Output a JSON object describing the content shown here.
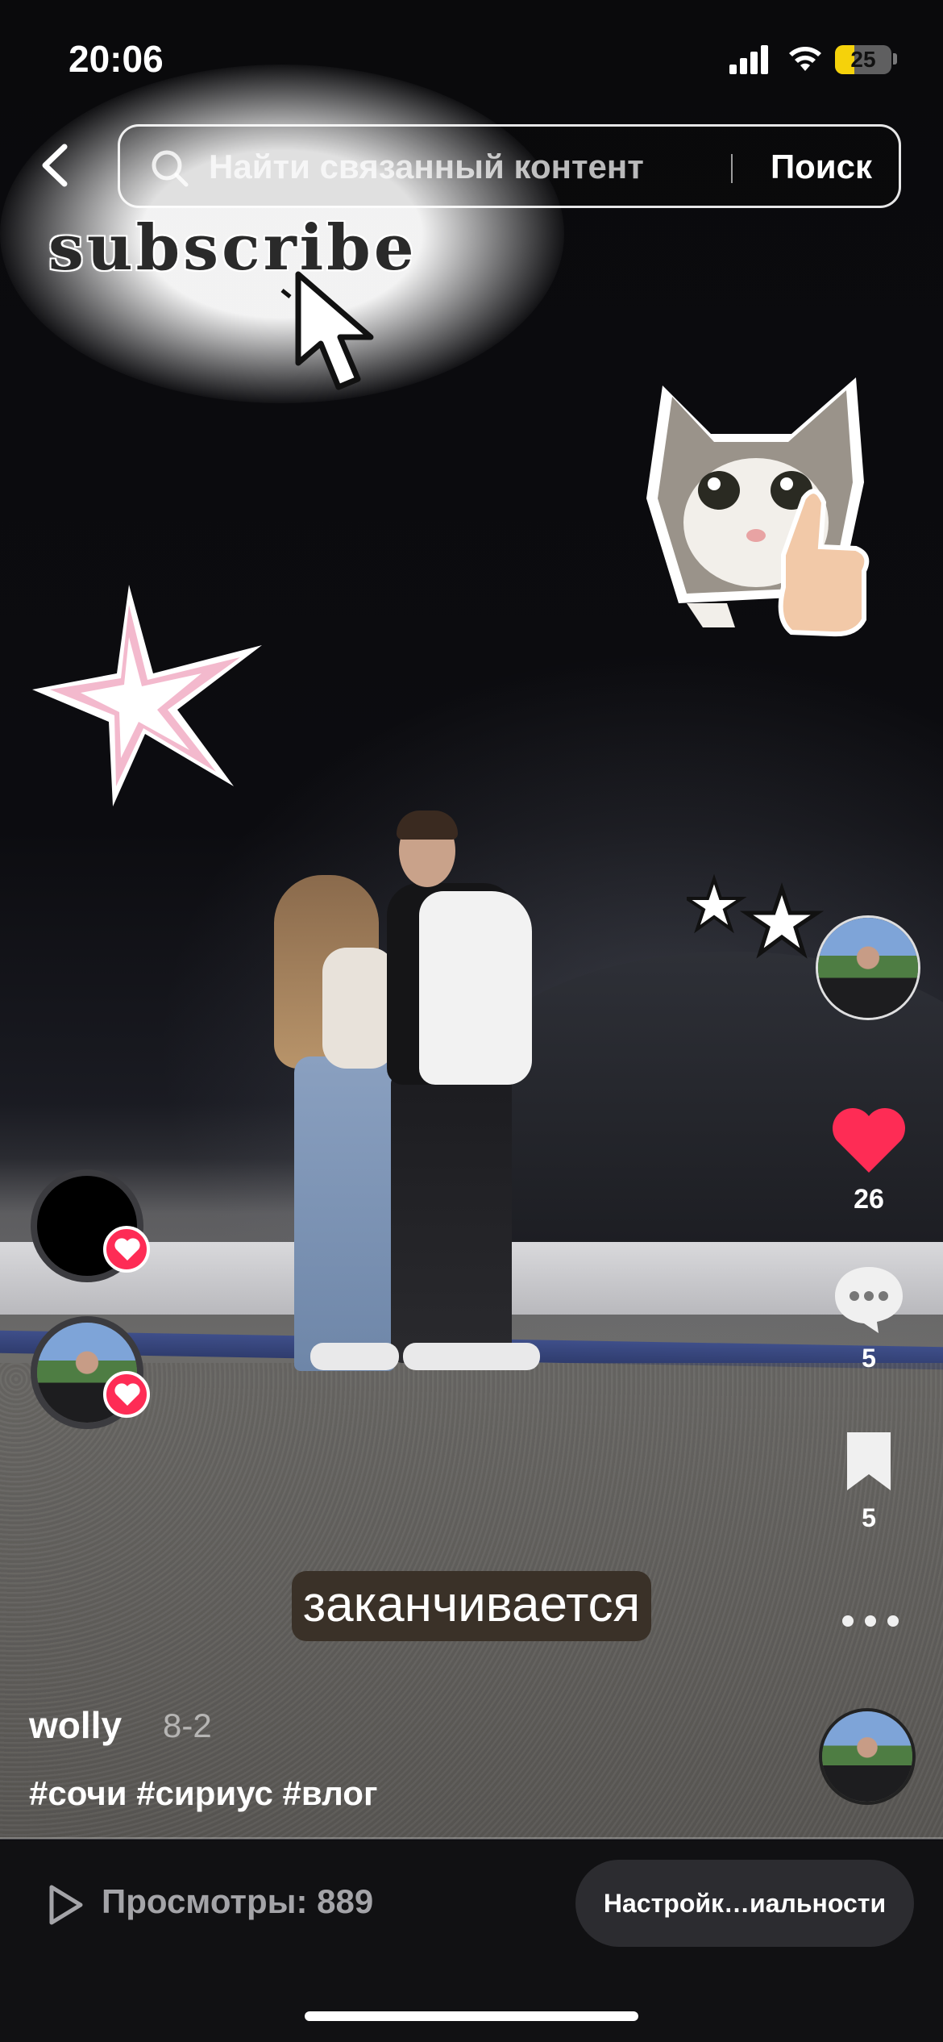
{
  "status_bar": {
    "time": "20:06",
    "battery": "25"
  },
  "search": {
    "placeholder": "Найти связанный контент",
    "button_label": "Поиск"
  },
  "stickers": {
    "subscribe_text": "subscribe"
  },
  "video": {
    "caption": "заканчивается"
  },
  "actions": {
    "like_count": "26",
    "comment_count": "5",
    "bookmark_count": "5"
  },
  "post": {
    "author": "wolly",
    "date": "8-2",
    "hashtags": "#сочи #сириус #влог"
  },
  "bottom_bar": {
    "views": "Просмотры: 889",
    "privacy_button": "Настройк…иальности"
  },
  "colors": {
    "like_red": "#fe2c55",
    "battery_yellow": "#f5d20b",
    "bottom_bg": "#111113"
  },
  "icons": [
    "back-arrow-icon",
    "search-icon",
    "heart-icon",
    "comment-icon",
    "bookmark-icon",
    "more-icon",
    "play-icon",
    "wifi-icon",
    "signal-icon",
    "battery-icon"
  ]
}
